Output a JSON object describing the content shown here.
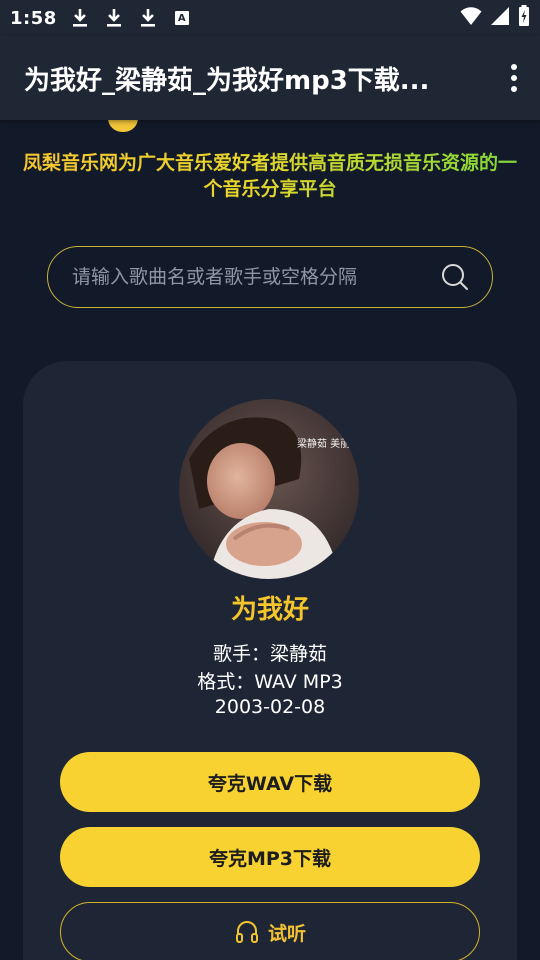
{
  "status_bar": {
    "time": "1:58",
    "icons": [
      "download-icon",
      "download-icon",
      "download-icon",
      "a-icon",
      "wifi-icon",
      "signal-icon",
      "battery-icon"
    ]
  },
  "app_bar": {
    "title": "为我好_梁静茹_为我好mp3下载..."
  },
  "tagline": "凤梨音乐网为广大音乐爱好者提供高音质无损音乐资源的一个音乐分享平台",
  "search": {
    "placeholder": "请输入歌曲名或者歌手或空格分隔",
    "value": ""
  },
  "song": {
    "title": "为我好",
    "artist_line": "歌手：梁静茹",
    "format_line": "格式：WAV MP3",
    "date": "2003-02-08",
    "cover_text": "梁静茹 美丽人生"
  },
  "buttons": {
    "wav_label": "夸克WAV下载",
    "mp3_label": "夸克MP3下载",
    "listen_label": "试听"
  },
  "colors": {
    "accent": "#f8d230",
    "background": "#121a29",
    "card": "#1e2534",
    "title_gold": "#f5c52c"
  }
}
